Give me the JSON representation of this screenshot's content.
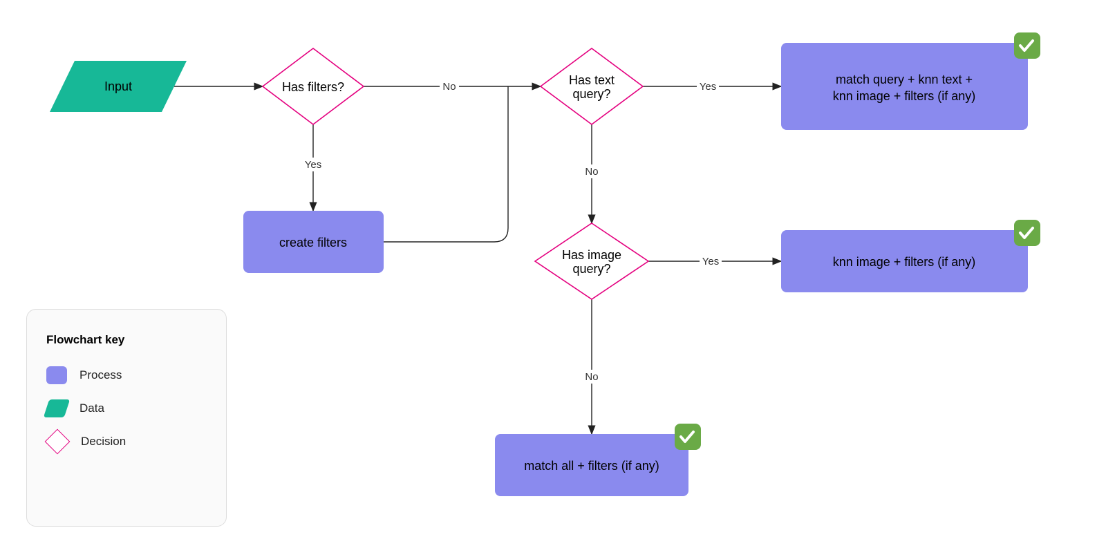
{
  "nodes": {
    "input": "Input",
    "has_filters": "Has filters?",
    "create_filters": "create filters",
    "has_text_query_l1": "Has text",
    "has_text_query_l2": "query?",
    "has_image_query_l1": "Has image",
    "has_image_query_l2": "query?",
    "match_query_l1": "match query + knn text +",
    "match_query_l2": "knn image + filters (if any)",
    "knn_image": "knn image + filters (if any)",
    "match_all": "match all + filters (if any)"
  },
  "edges": {
    "yes": "Yes",
    "no": "No"
  },
  "legend": {
    "title": "Flowchart key",
    "process": "Process",
    "data": "Data",
    "decision": "Decision"
  },
  "colors": {
    "process": "#8a8aee",
    "data": "#17b897",
    "decision_border": "#e4007f",
    "check_badge": "#6aaa46",
    "arrow": "#222222"
  }
}
